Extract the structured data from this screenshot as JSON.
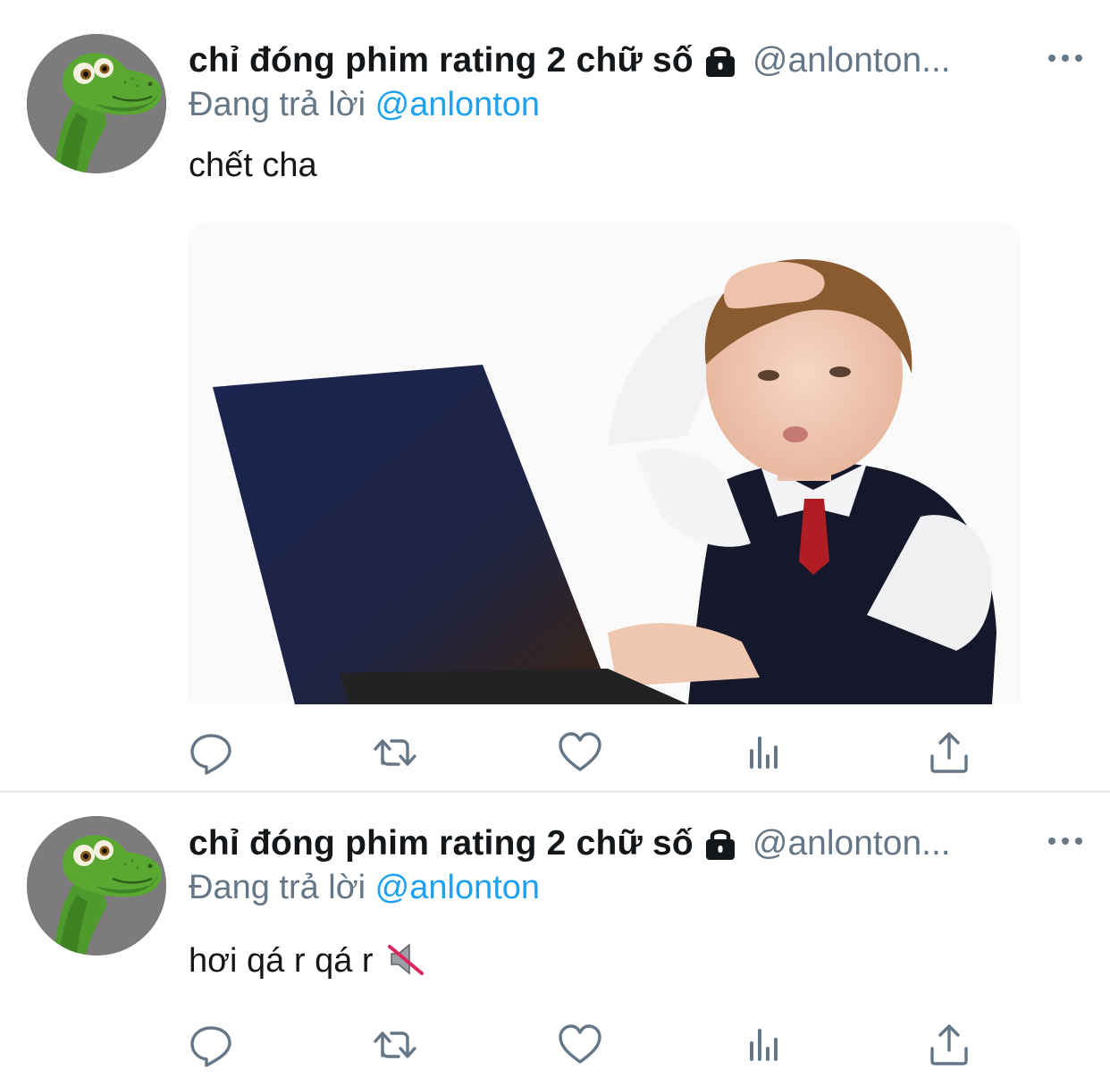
{
  "tweets": [
    {
      "display_name": "chỉ đóng phim rating 2 chữ số",
      "handle": "@anlonton...",
      "replying_prefix": "Đang trả lời",
      "replying_to": "@anlonton",
      "text": "chết cha",
      "has_media": true,
      "media_description_icon": "photo-boy-with-laptop"
    },
    {
      "display_name": "chỉ đóng phim rating 2 chữ số",
      "handle": "@anlonton...",
      "replying_prefix": "Đang trả lời",
      "replying_to": "@anlonton",
      "text": "hơi qá r qá r",
      "text_emoji_icon": "muted-speaker-icon",
      "has_media": false
    }
  ],
  "colors": {
    "name": "#14171a",
    "secondary": "#657786",
    "link": "#1da1f2",
    "icon": "#657786",
    "divider": "#e6ecf0"
  },
  "icons": [
    "avatar-dinosaur",
    "lock-icon",
    "more-icon",
    "reply-icon",
    "retweet-icon",
    "like-icon",
    "stats-icon",
    "share-icon"
  ]
}
